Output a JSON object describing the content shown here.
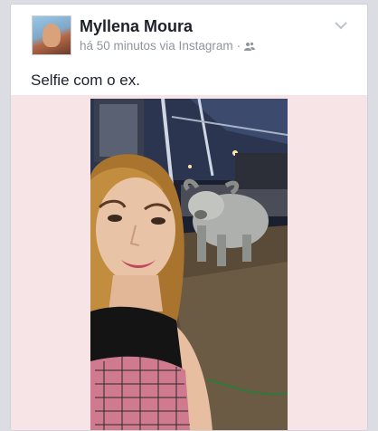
{
  "post": {
    "author": "Myllena Moura",
    "timestamp": "há 50 minutos via Instagram",
    "separator": "·",
    "text": "Selfie com o ex."
  },
  "icons": {
    "audience": "friends-icon",
    "menu": "chevron-down-icon"
  },
  "colors": {
    "name": "#1d2129",
    "meta": "#90949c",
    "photo_bg": "#f6e4e6"
  }
}
